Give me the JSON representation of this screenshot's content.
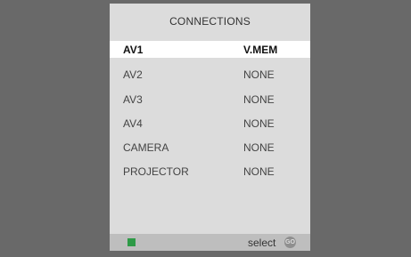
{
  "menu": {
    "title": "CONNECTIONS",
    "items": [
      {
        "label": "AV1",
        "value": "V.MEM"
      },
      {
        "label": "AV2",
        "value": "NONE"
      },
      {
        "label": "AV3",
        "value": "NONE"
      },
      {
        "label": "AV4",
        "value": "NONE"
      },
      {
        "label": "CAMERA",
        "value": "NONE"
      },
      {
        "label": "PROJECTOR",
        "value": "NONE"
      }
    ]
  },
  "footer": {
    "select_label": "select",
    "go_label": "GO",
    "green_color": "#2e9a47"
  }
}
